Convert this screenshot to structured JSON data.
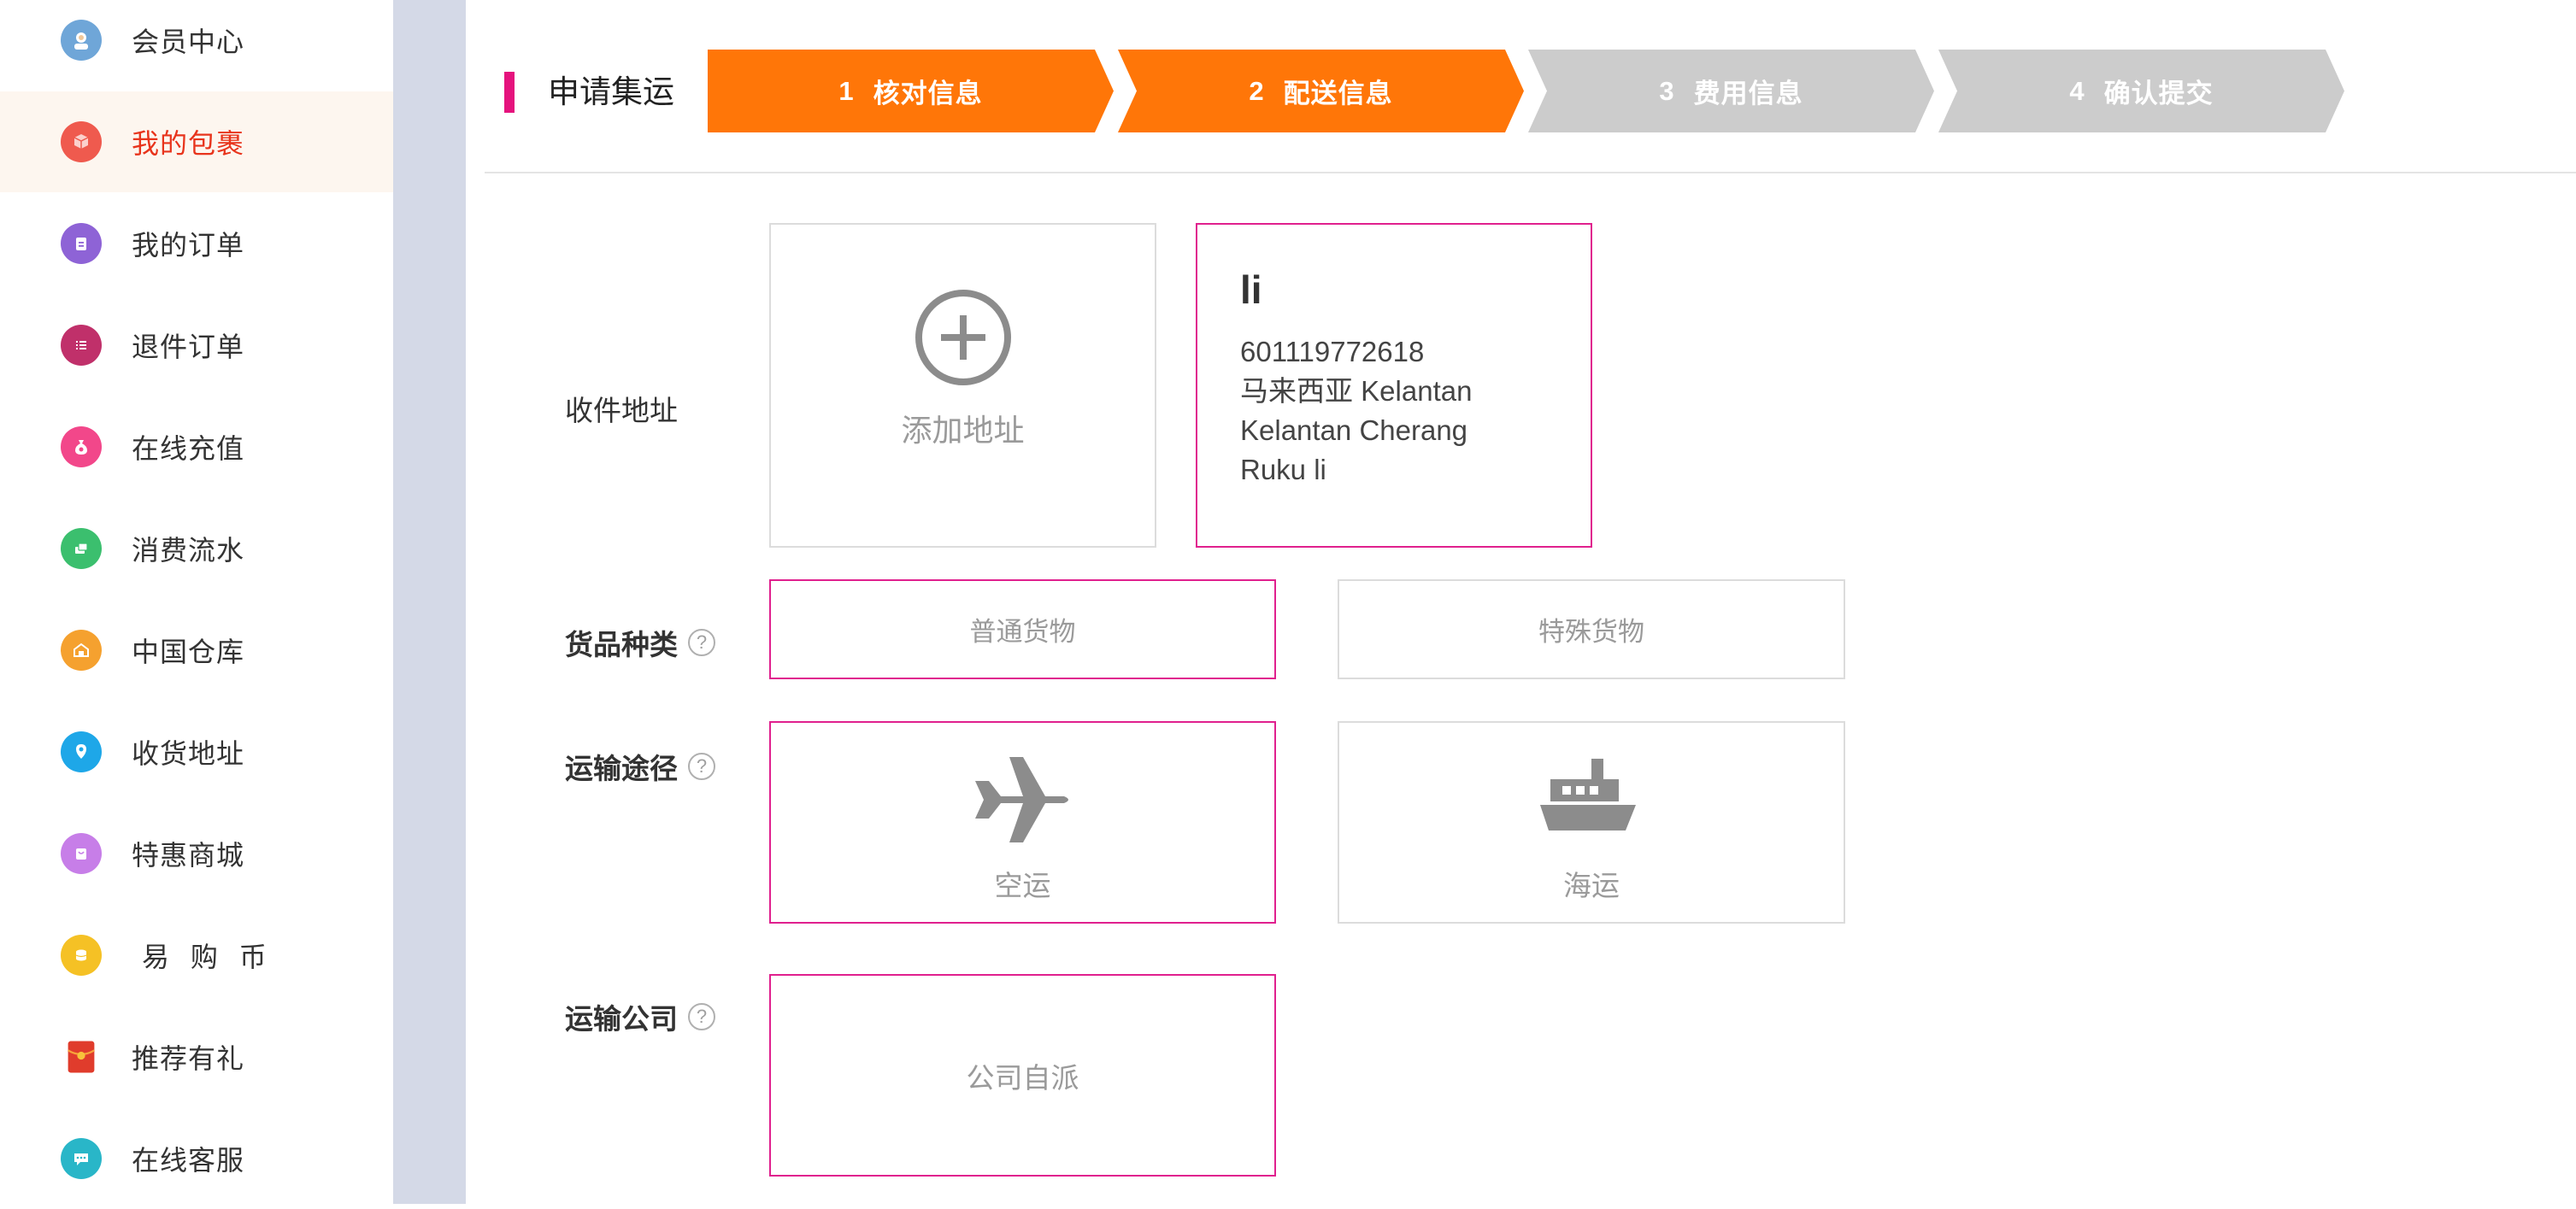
{
  "sidebar": {
    "items": [
      {
        "label": "会员中心",
        "icon": "member-icon",
        "color": "#6fa6d8"
      },
      {
        "label": "我的包裹",
        "icon": "package-icon",
        "color": "#ef5a4e"
      },
      {
        "label": "我的订单",
        "icon": "order-icon",
        "color": "#8e63d6"
      },
      {
        "label": "退件订单",
        "icon": "return-icon",
        "color": "#c0306a"
      },
      {
        "label": "在线充值",
        "icon": "moneybag-icon",
        "color": "#f2478a"
      },
      {
        "label": "消费流水",
        "icon": "bills-icon",
        "color": "#3bbf6e"
      },
      {
        "label": "中国仓库",
        "icon": "warehouse-icon",
        "color": "#f5a12f"
      },
      {
        "label": "收货地址",
        "icon": "location-icon",
        "color": "#1ea7e8"
      },
      {
        "label": "特惠商城",
        "icon": "shop-icon",
        "color": "#c77ee8"
      },
      {
        "label": "易 购 币",
        "icon": "coin-icon",
        "color": "#f5c125"
      },
      {
        "label": "推荐有礼",
        "icon": "redpacket-icon",
        "color": "#e03c2c"
      },
      {
        "label": "在线客服",
        "icon": "chat-icon",
        "color": "#29b6c8"
      }
    ],
    "active_index": 1
  },
  "page": {
    "title": "申请集运",
    "accent": "#e5127d"
  },
  "steps": [
    {
      "num": "1",
      "label": "核对信息",
      "state": "done"
    },
    {
      "num": "2",
      "label": "配送信息",
      "state": "done"
    },
    {
      "num": "3",
      "label": "费用信息",
      "state": "todo"
    },
    {
      "num": "4",
      "label": "确认提交",
      "state": "todo"
    }
  ],
  "address": {
    "label": "收件地址",
    "add_label": "添加地址",
    "name": "li",
    "phone": "601119772618",
    "line1": "马来西亚 Kelantan",
    "line2": "Kelantan Cherang",
    "line3": "Ruku li"
  },
  "goods": {
    "label": "货品种类",
    "options": [
      "普通货物",
      "特殊货物"
    ],
    "selected": 0
  },
  "route": {
    "label": "运输途径",
    "options": [
      {
        "label": "空运",
        "icon": "airplane-icon"
      },
      {
        "label": "海运",
        "icon": "ship-icon"
      }
    ],
    "selected": 0
  },
  "carrier": {
    "label": "运输公司",
    "option": "公司自派"
  }
}
